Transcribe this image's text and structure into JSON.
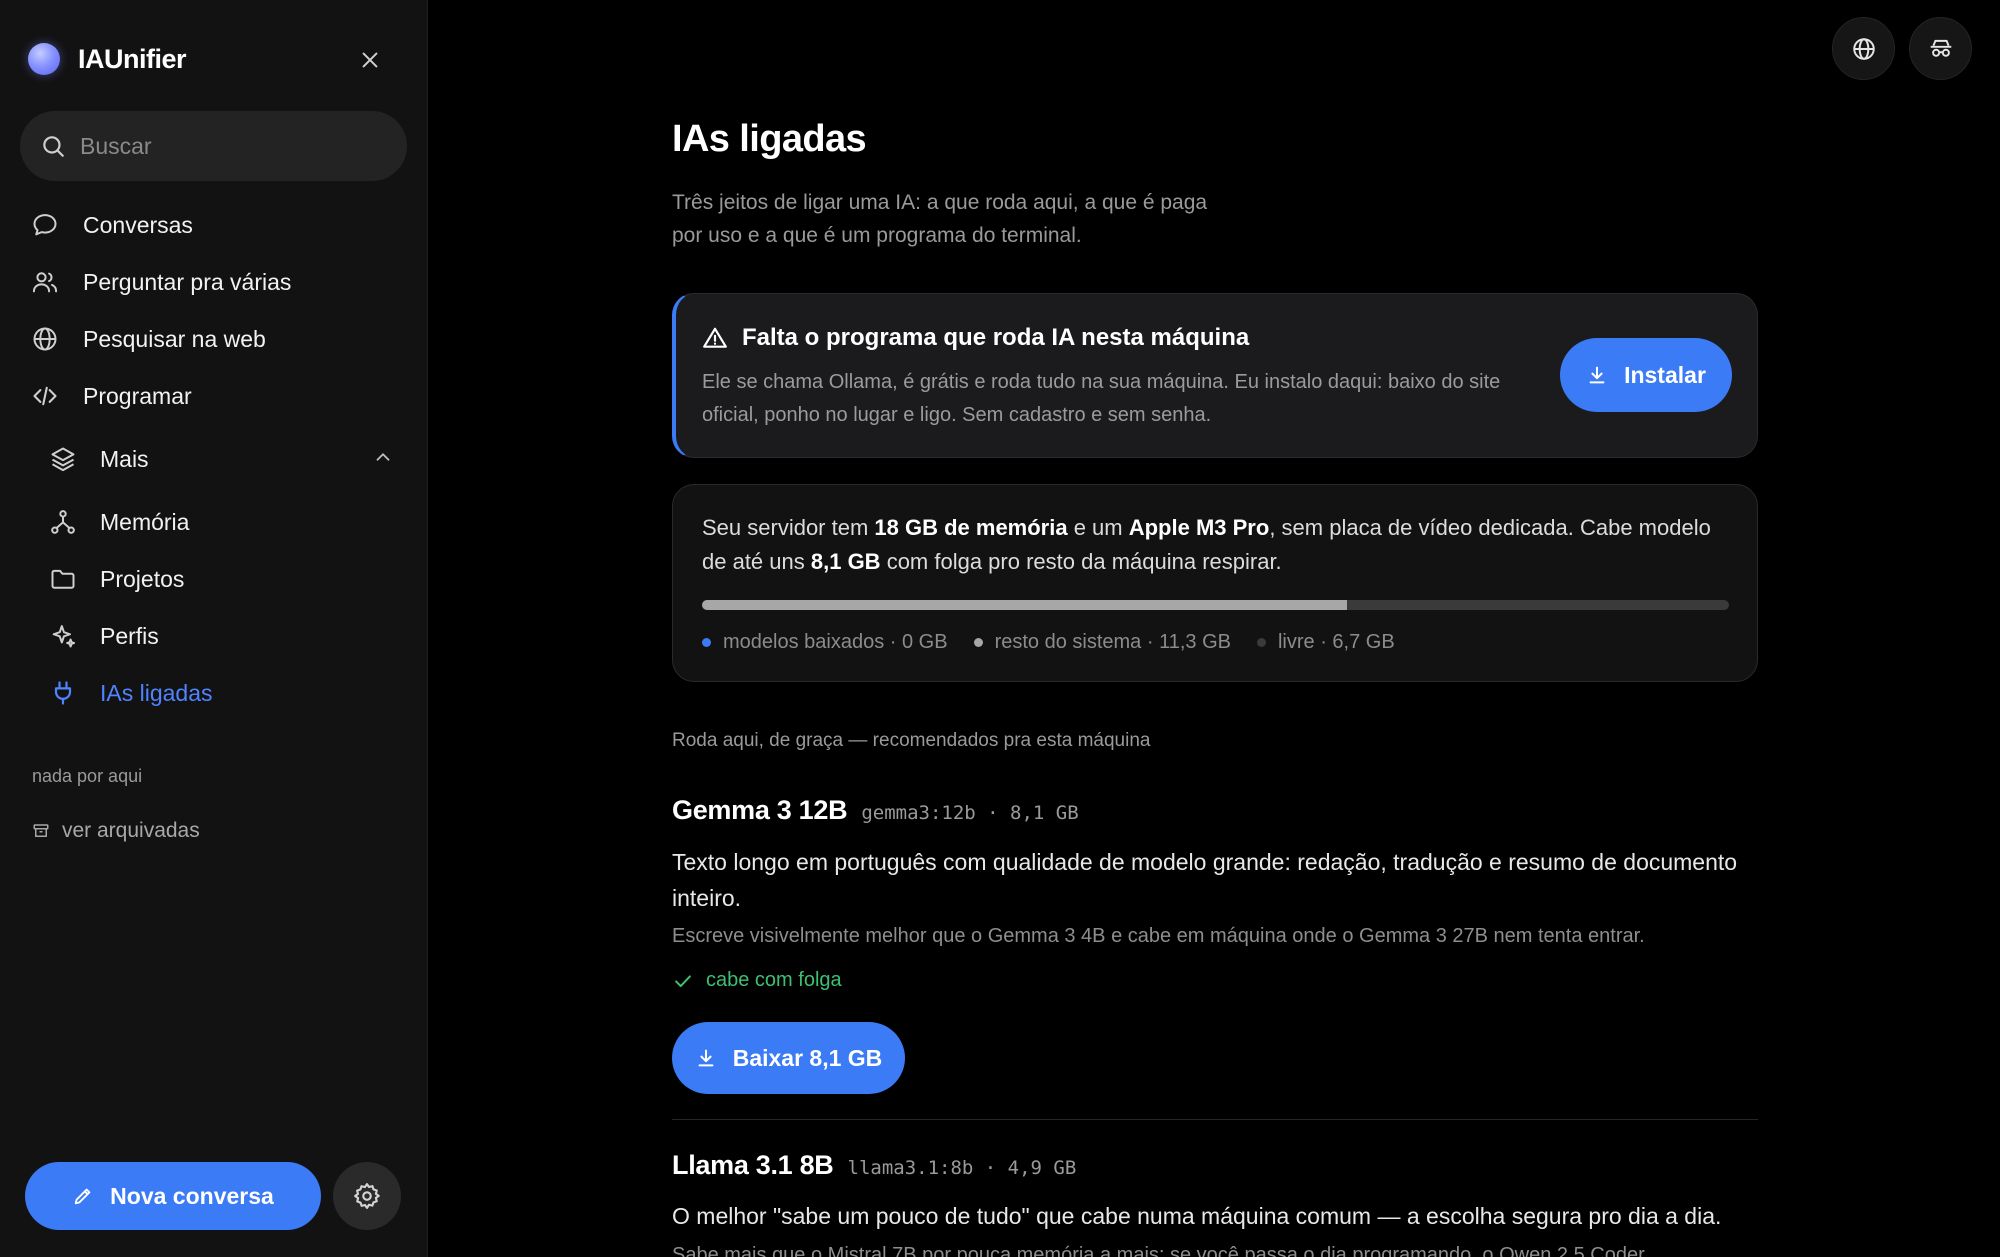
{
  "app": {
    "name": "IAUnifier"
  },
  "sidebar": {
    "search_placeholder": "Buscar",
    "items": [
      {
        "label": "Conversas",
        "icon": "chat-bubble-icon"
      },
      {
        "label": "Perguntar pra várias",
        "icon": "users-icon"
      },
      {
        "label": "Pesquisar na web",
        "icon": "globe-icon"
      },
      {
        "label": "Programar",
        "icon": "code-icon"
      }
    ],
    "more": {
      "label": "Mais",
      "icon": "layers-icon",
      "expanded": true,
      "items": [
        {
          "label": "Memória",
          "icon": "network-icon"
        },
        {
          "label": "Projetos",
          "icon": "folder-icon"
        },
        {
          "label": "Perfis",
          "icon": "sparkle-icon"
        },
        {
          "label": "IAs ligadas",
          "icon": "plug-icon",
          "active": true
        }
      ]
    },
    "empty_label": "nada por aqui",
    "archived_label": "ver arquivadas",
    "new_chat_label": "Nova conversa"
  },
  "colors": {
    "accent": "#3b7bf6",
    "active_text": "#4f83ff",
    "success": "#3fbf72"
  },
  "page": {
    "title": "IAs ligadas",
    "subtitle": "Três jeitos de ligar uma IA: a que roda aqui, a que é paga por uso e a que é um programa do terminal."
  },
  "alert": {
    "title": "Falta o programa que roda IA nesta máquina",
    "text": "Ele se chama Ollama, é grátis e roda tudo na sua máquina. Eu instalo daqui: baixo do site oficial, ponho no lugar e ligo. Sem cadastro e sem senha.",
    "button_label": "Instalar"
  },
  "memory": {
    "text_1": "Seu servidor tem ",
    "ram": "18 GB de memória",
    "text_2": " e um ",
    "cpu": "Apple M3 Pro",
    "text_3": ", sem placa de vídeo dedicada. Cabe modelo de até uns ",
    "max_model": "8,1 GB",
    "text_4": " com folga pro resto da máquina respirar.",
    "usage": {
      "models_gb": 0,
      "system_gb": 11.3,
      "free_gb": 6.7,
      "total_gb": 18
    },
    "legend": [
      {
        "label": "modelos baixados · 0 GB",
        "color": "#3b7bf6"
      },
      {
        "label": "resto do sistema · 11,3 GB",
        "color": "#a7a7a7"
      },
      {
        "label": "livre · 6,7 GB",
        "color": "#3a3a3a"
      }
    ]
  },
  "section": {
    "title": "Roda aqui, de graça — recomendados pra esta máquina"
  },
  "models": [
    {
      "name": "Gemma 3 12B",
      "meta": "gemma3:12b · 8,1 GB",
      "description": "Texto longo em português com qualidade de modelo grande: redação, tradução e resumo de documento inteiro.",
      "note": "Escreve visivelmente melhor que o Gemma 3 4B e cabe em máquina onde o Gemma 3 27B nem tenta entrar.",
      "fit": "cabe com folga",
      "button_label": "Baixar 8,1 GB"
    },
    {
      "name": "Llama 3.1 8B",
      "meta": "llama3.1:8b · 4,9 GB",
      "description": "O melhor \"sabe um pouco de tudo\" que cabe numa máquina comum — a escolha segura pro dia a dia.",
      "note": "Sabe mais que o Mistral 7B por pouca memória a mais; se você passa o dia programando, o Qwen 2.5 Coder"
    }
  ]
}
